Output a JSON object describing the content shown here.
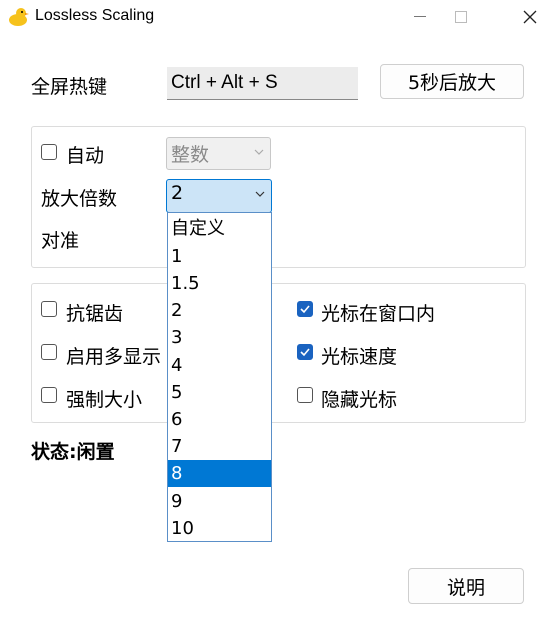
{
  "window": {
    "title": "Lossless Scaling"
  },
  "hotkey": {
    "label": "全屏热键",
    "value": "Ctrl + Alt + S",
    "scale_button": "5秒后放大"
  },
  "scale_group": {
    "auto_label": "自动",
    "auto_checked": false,
    "mode_value": "整数",
    "factor_label": "放大倍数",
    "factor_value": "2",
    "align_label": "对准"
  },
  "factor_dropdown": {
    "items": [
      "自定义",
      "1",
      "1.5",
      "2",
      "3",
      "4",
      "5",
      "6",
      "7",
      "8",
      "9",
      "10"
    ],
    "highlighted": "8"
  },
  "options": {
    "antialias": {
      "label": "抗锯齿",
      "checked": false
    },
    "multi_display": {
      "label": "启用多显示",
      "checked": false
    },
    "force_size": {
      "label": "强制大小",
      "checked": false
    },
    "cursor_in_window": {
      "label": "光标在窗口内",
      "checked": true
    },
    "cursor_speed": {
      "label": "光标速度",
      "checked": true
    },
    "hide_cursor": {
      "label": "隐藏光标",
      "checked": false
    }
  },
  "status": {
    "text": "状态:闲置"
  },
  "help_button": "说明",
  "colors": {
    "accent": "#0078d4",
    "checkbox_checked": "#1a63c0",
    "combo_active_bg": "#cce4f7"
  }
}
